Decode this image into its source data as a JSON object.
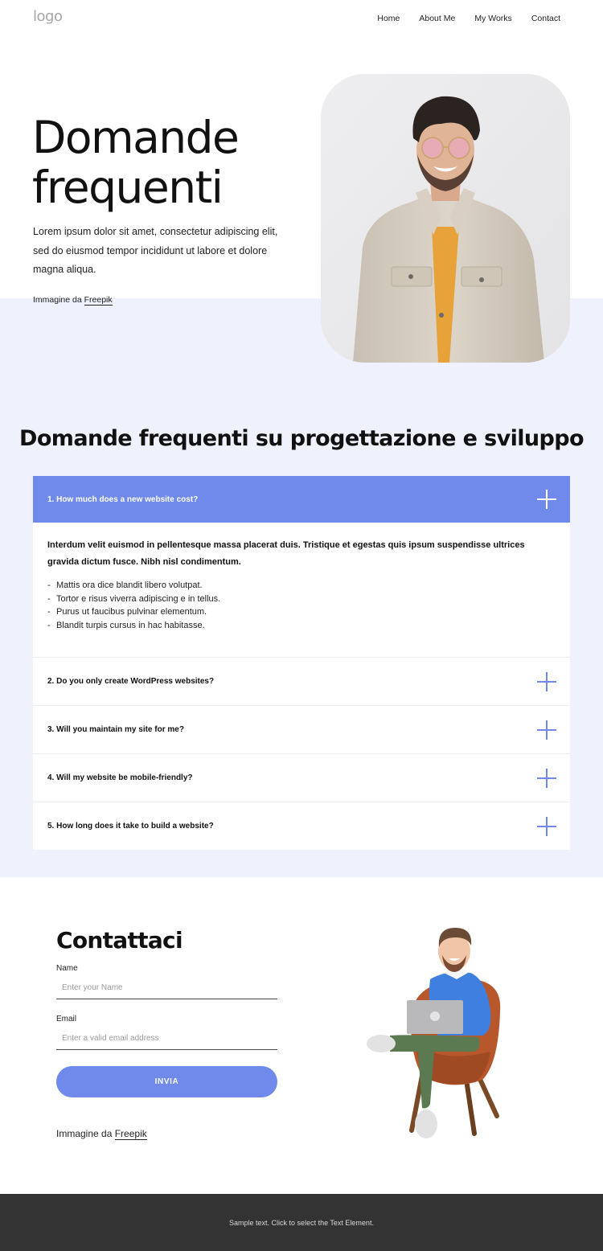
{
  "header": {
    "logo": "logo",
    "nav": [
      "Home",
      "About Me",
      "My Works",
      "Contact"
    ]
  },
  "hero": {
    "title_line1": "Domande",
    "title_line2": "frequenti",
    "text": "Lorem ipsum dolor sit amet, consectetur adipiscing elit, sed do eiusmod tempor incididunt ut labore et dolore magna aliqua.",
    "credit_prefix": "Immagine da",
    "credit_link": "Freepik",
    "photo": "smiling man with pink sunglasses in beige denim jacket"
  },
  "faq": {
    "title": "Domande frequenti su progettazione e sviluppo",
    "items": [
      {
        "question": "1. How much does a new website cost?",
        "expanded": true,
        "answer_lead": "Interdum velit euismod in pellentesque massa placerat duis. Tristique et egestas quis ipsum suspendisse ultrices gravida dictum fusce. Nibh nisl condimentum.",
        "answer_list": [
          "Mattis ora dice blandit libero volutpat.",
          "Tortor e risus viverra adipiscing e in tellus.",
          "Purus ut faucibus pulvinar elementum.",
          "Blandit turpis cursus in hac habitasse."
        ]
      },
      {
        "question": "2. Do you only create WordPress websites?",
        "expanded": false
      },
      {
        "question": "3. Will you maintain my site for me?",
        "expanded": false
      },
      {
        "question": "4. Will my website be mobile-friendly?",
        "expanded": false
      },
      {
        "question": "5. How long does it take to build a website?",
        "expanded": false
      }
    ]
  },
  "contact": {
    "title": "Contattaci",
    "name_label": "Name",
    "name_placeholder": "Enter your Name",
    "email_label": "Email",
    "email_placeholder": "Enter a valid email address",
    "submit_label": "INVIA",
    "credit_prefix": "Immagine da",
    "credit_link": "Freepik",
    "illustration": "3D cartoon man sitting in armchair with laptop"
  },
  "footer": {
    "text": "Sample text. Click to select the Text Element."
  },
  "colors": {
    "accent": "#6f8aeb",
    "section_bg": "#eff1fc",
    "footer_bg": "#333333"
  }
}
